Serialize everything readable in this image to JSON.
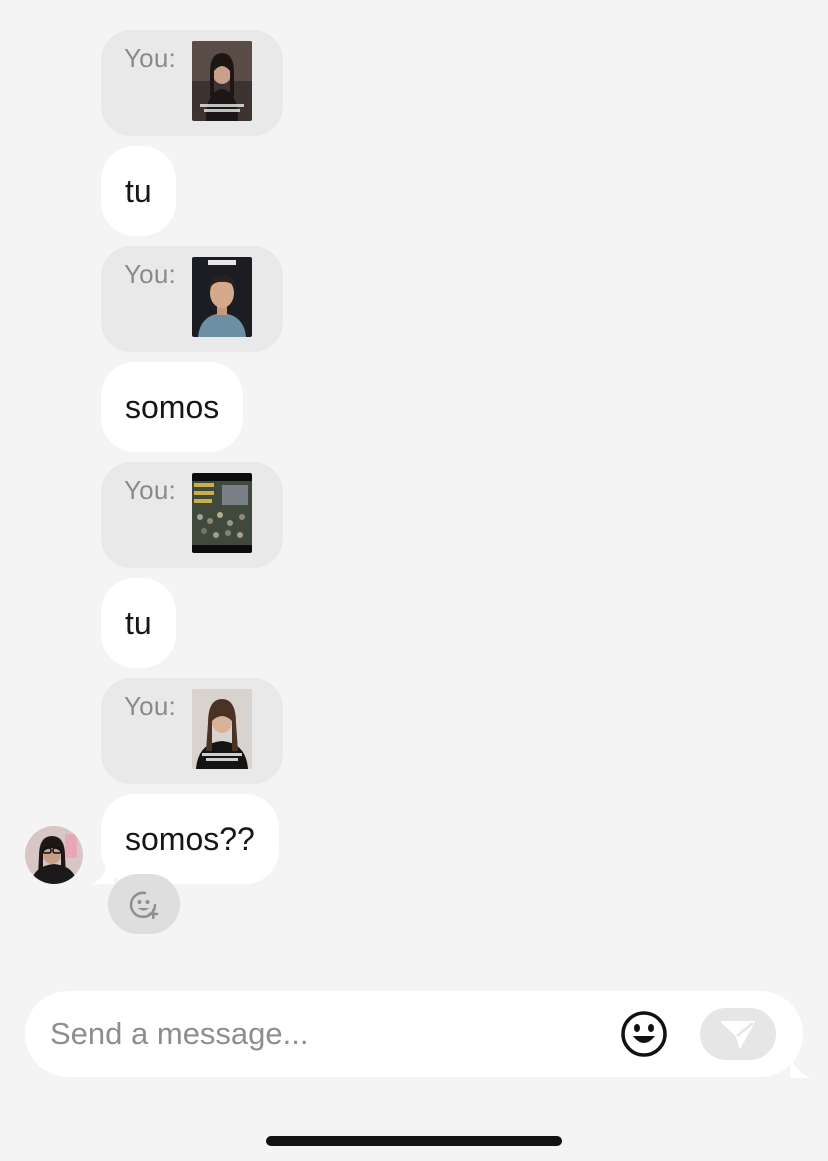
{
  "messages": [
    {
      "type": "shared",
      "sender_label": "You:",
      "thumbnail": "video-thumbnail-woman-talking"
    },
    {
      "type": "text",
      "text": "tu"
    },
    {
      "type": "shared",
      "sender_label": "You:",
      "thumbnail": "video-thumbnail-man-talking"
    },
    {
      "type": "text",
      "text": "somos"
    },
    {
      "type": "shared",
      "sender_label": "You:",
      "thumbnail": "video-thumbnail-crowd"
    },
    {
      "type": "text",
      "text": "tu"
    },
    {
      "type": "shared",
      "sender_label": "You:",
      "thumbnail": "video-thumbnail-woman-dark-top"
    },
    {
      "type": "text",
      "text": "somos??"
    }
  ],
  "reaction_button": {
    "icon": "add-reaction-icon"
  },
  "composer": {
    "placeholder": "Send a message...",
    "value": "",
    "emoji_icon": "emoji-icon",
    "send_icon": "send-icon"
  },
  "colors": {
    "background": "#f4f4f4",
    "shared_bubble": "#e9e9e9",
    "text_bubble": "#ffffff",
    "muted_text": "#8a8a8a"
  }
}
